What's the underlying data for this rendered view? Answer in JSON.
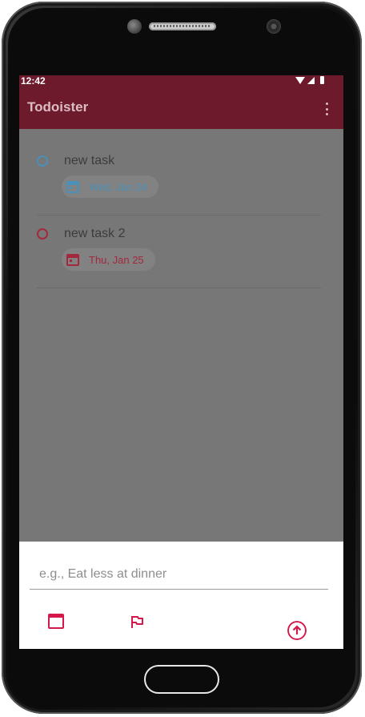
{
  "status_bar": {
    "time": "12:42"
  },
  "app_bar": {
    "title": "Todoister"
  },
  "tasks": [
    {
      "title": "new task",
      "due": "Wed, Jan 24",
      "accent": "#4a90b8"
    },
    {
      "title": "new task 2",
      "due": "Thu, Jan 25",
      "accent": "#a3283d"
    }
  ],
  "new_task": {
    "placeholder": "e.g., Eat less at dinner",
    "value": ""
  },
  "colors": {
    "app_bar": "#6d1a2c",
    "scrim": "#777777",
    "accent": "#d4184a"
  },
  "icons": {
    "date_button": "calendar-icon",
    "priority_button": "flag-icon",
    "submit_button": "arrow-up-circle-icon",
    "menu": "more-vert-icon"
  }
}
